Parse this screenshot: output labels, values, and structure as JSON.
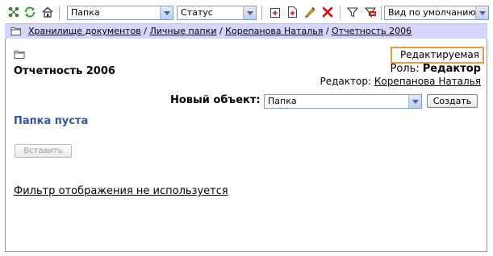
{
  "toolbar": {
    "icons": [
      "tree-icon",
      "refresh-icon",
      "home-icon",
      "new-folder-icon",
      "new-document-icon",
      "edit-icon",
      "delete-icon",
      "filter-icon",
      "filter-off-icon"
    ],
    "type_select": "Папка",
    "status_select": "Статус",
    "view_select": "Вид по умолчанию"
  },
  "breadcrumb": {
    "items": [
      "Хранилище документов",
      "Личные папки",
      "Корепанова Наталья",
      "Отчетность 2006"
    ],
    "separator": " / "
  },
  "main": {
    "folder_title": "Отчетность 2006",
    "status": "Редактируемая",
    "role_label": "Роль:",
    "role_value": "Редактор",
    "editor_label": "Редактор:",
    "editor_name": "Корепанова Наталья",
    "new_object_label": "Новый объект:",
    "new_object_select": "Папка",
    "create_button": "Создать",
    "empty_text": "Папка пуста",
    "insert_button": "Вставить",
    "filter_link": "Фильтр отображения не используется"
  },
  "colors": {
    "crumb_bg": "#d5d5ff",
    "status_border": "#ee9a3a",
    "empty_text": "#2f55a8",
    "delete_red": "#e00000"
  }
}
